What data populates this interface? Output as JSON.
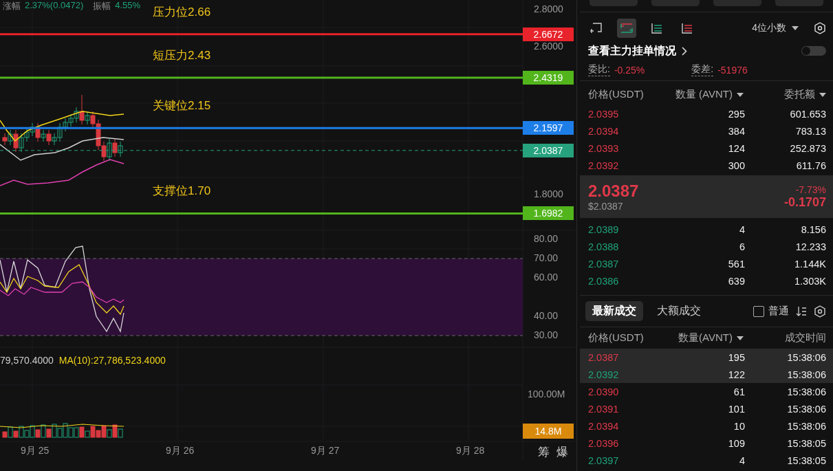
{
  "header_stats": [
    {
      "label": "涨幅",
      "value": "2.37%(0.0472)"
    },
    {
      "label": "振幅",
      "value": "4.55%"
    }
  ],
  "price_chart": {
    "axis": [
      "2.8000",
      "2.6000",
      "1.8000"
    ],
    "levels": [
      {
        "label": "压力位2.66",
        "tag": "2.6672",
        "color": "#e8232b"
      },
      {
        "label": "短压力2.43",
        "tag": "2.4319",
        "color": "#52b51c"
      },
      {
        "label": "关键位2.15",
        "tag": "2.1597",
        "color": "#1e7ee8"
      },
      {
        "label": "支撑位1.70",
        "tag": "1.6982",
        "color": "#52b51c"
      }
    ],
    "last_price": {
      "tag": "2.0387",
      "color": "#27a27e"
    }
  },
  "rsi": {
    "axis": [
      "80.00",
      "70.00",
      "60.00",
      "40.00",
      "30.00"
    ]
  },
  "volume": {
    "ma_texts": [
      {
        "text": "79,570.4000",
        "color": "#cfcfcf"
      },
      {
        "text": "MA(10):27,786,523.4000",
        "color": "#f2d51b"
      }
    ],
    "axis": "100.00M",
    "tag": "14.8M"
  },
  "dates": [
    "9月 25",
    "9月 26",
    "9月 27",
    "9月 28"
  ],
  "chart_tools": [
    "筹",
    "爆"
  ],
  "toolbar": {
    "views": [
      {
        "kind": "add",
        "selected": false
      },
      {
        "kind": "both",
        "selected": true
      },
      {
        "kind": "bids",
        "selected": false
      },
      {
        "kind": "asks",
        "selected": false
      }
    ],
    "decimals": "4位小数"
  },
  "main_orders": {
    "label": "查看主力挂单情况",
    "on": false
  },
  "ratio": {
    "label": "委比:",
    "value": "-0.25%"
  },
  "diff": {
    "label": "委差:",
    "value": "-51976"
  },
  "book_columns": [
    "价格(USDT)",
    "数量 (AVNT)",
    "委托额"
  ],
  "asks": [
    {
      "price": "2.0395",
      "amount": "295",
      "total": "601.653"
    },
    {
      "price": "2.0394",
      "amount": "384",
      "total": "783.13"
    },
    {
      "price": "2.0393",
      "amount": "124",
      "total": "252.873"
    },
    {
      "price": "2.0392",
      "amount": "300",
      "total": "611.76"
    }
  ],
  "mid": {
    "price": "2.0387",
    "usd": "$2.0387",
    "change_pct": "-7.73%",
    "change": "-0.1707"
  },
  "bids": [
    {
      "price": "2.0389",
      "amount": "4",
      "total": "8.156"
    },
    {
      "price": "2.0388",
      "amount": "6",
      "total": "12.233"
    },
    {
      "price": "2.0387",
      "amount": "561",
      "total": "1.144K"
    },
    {
      "price": "2.0386",
      "amount": "639",
      "total": "1.303K"
    }
  ],
  "trade_tabs": [
    {
      "label": "最新成交",
      "selected": true
    },
    {
      "label": "大额成交",
      "selected": false
    }
  ],
  "normal_filter": {
    "label": "普通",
    "checked": false
  },
  "trade_columns": [
    "价格(USDT)",
    "数量(AVNT)",
    "成交时间"
  ],
  "trades": [
    {
      "price": "2.0387",
      "amount": "195",
      "time": "15:38:06",
      "color": "#e0394a",
      "highlighted": true
    },
    {
      "price": "2.0392",
      "amount": "122",
      "time": "15:38:06",
      "color": "#1fa37a",
      "highlighted": true
    },
    {
      "price": "2.0390",
      "amount": "61",
      "time": "15:38:06",
      "color": "#e0394a",
      "highlighted": false
    },
    {
      "price": "2.0391",
      "amount": "101",
      "time": "15:38:06",
      "color": "#e0394a",
      "highlighted": false
    },
    {
      "price": "2.0394",
      "amount": "10",
      "time": "15:38:06",
      "color": "#e0394a",
      "highlighted": false
    },
    {
      "price": "2.0396",
      "amount": "109",
      "time": "15:38:05",
      "color": "#e0394a",
      "highlighted": false
    },
    {
      "price": "2.0397",
      "amount": "4",
      "time": "15:38:05",
      "color": "#1fa37a",
      "highlighted": false
    }
  ]
}
